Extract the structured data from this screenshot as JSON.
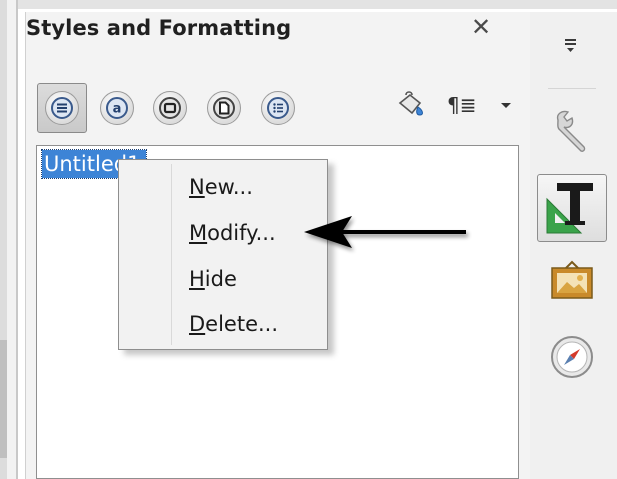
{
  "panel": {
    "title": "Styles and Formatting",
    "close_label": "✕"
  },
  "toolbar": {
    "buttons": [
      {
        "icon": "paragraph-styles-icon",
        "active": true
      },
      {
        "icon": "character-styles-icon",
        "active": false
      },
      {
        "icon": "frame-styles-icon",
        "active": false
      },
      {
        "icon": "page-styles-icon",
        "active": false
      },
      {
        "icon": "list-styles-icon",
        "active": false
      }
    ],
    "fill_format_icon": "fill-format-mode-icon",
    "new_style_label": "¶≣",
    "dropdown_icon": "dropdown-arrow-icon"
  },
  "list": {
    "selected_item": "Untitled1"
  },
  "context_menu": {
    "items": [
      {
        "mnemonic": "N",
        "rest": "ew..."
      },
      {
        "mnemonic": "M",
        "rest": "odify..."
      },
      {
        "mnemonic": "H",
        "rest": "ide"
      },
      {
        "mnemonic": "D",
        "rest": "elete..."
      }
    ]
  },
  "sidebar": {
    "menu_icon": "sidebar-menu-icon",
    "icons": [
      "properties-wrench-icon",
      "styles-and-formatting-icon",
      "gallery-icon",
      "navigator-compass-icon"
    ]
  },
  "colors": {
    "selection": "#3d84d6",
    "panel_bg": "#f3f3f3"
  }
}
